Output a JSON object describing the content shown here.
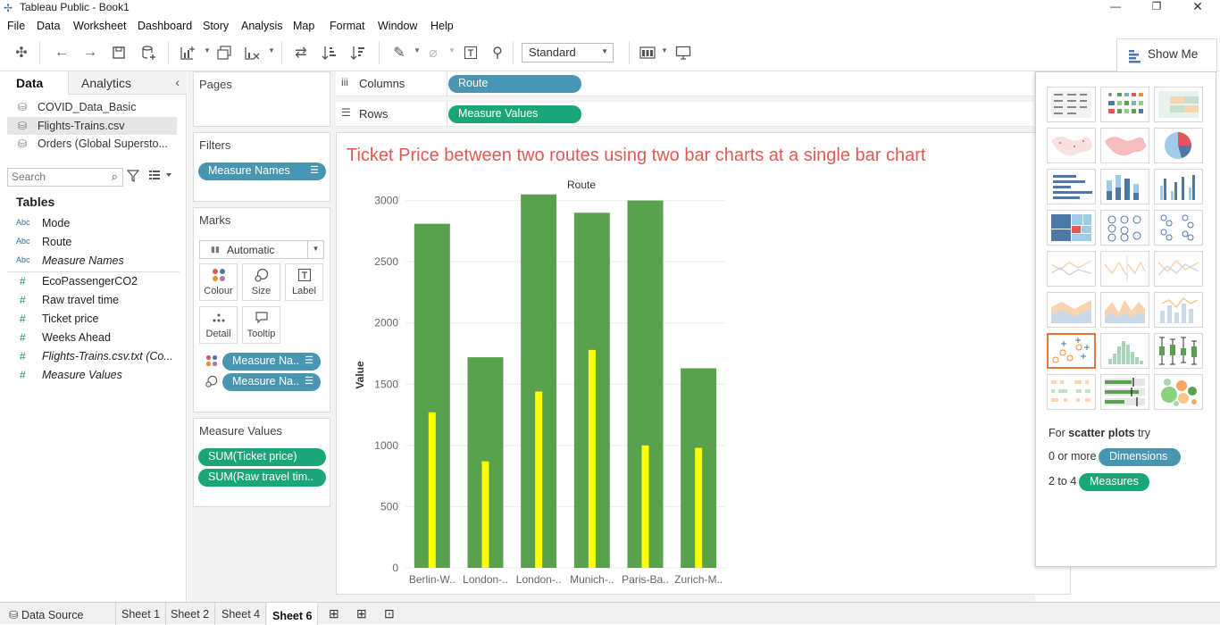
{
  "window": {
    "title": "Tableau Public - Book1"
  },
  "menu": [
    "File",
    "Data",
    "Worksheet",
    "Dashboard",
    "Story",
    "Analysis",
    "Map",
    "Format",
    "Window",
    "Help"
  ],
  "toolbar": {
    "fit_select": "Standard",
    "show_me_label": "Show Me"
  },
  "data_pane": {
    "tabs": {
      "data": "Data",
      "analytics": "Analytics"
    },
    "sources": [
      "COVID_Data_Basic",
      "Flights-Trains.csv",
      "Orders (Global Supersto..."
    ],
    "search_placeholder": "Search",
    "tables_heading": "Tables",
    "dimensions": [
      {
        "type": "Abc",
        "label": "Mode"
      },
      {
        "type": "Abc",
        "label": "Route"
      },
      {
        "type": "Abc",
        "label": "Measure Names"
      }
    ],
    "measures": [
      {
        "type": "#",
        "label": "EcoPassengerCO2"
      },
      {
        "type": "#",
        "label": "Raw travel time"
      },
      {
        "type": "#",
        "label": "Ticket price"
      },
      {
        "type": "#",
        "label": "Weeks Ahead"
      },
      {
        "type": "#",
        "label": "Flights-Trains.csv.txt (Co..."
      },
      {
        "type": "#",
        "label": "Measure Values"
      }
    ]
  },
  "cards": {
    "pages": "Pages",
    "filters": {
      "title": "Filters",
      "pill": "Measure Names"
    },
    "marks": {
      "title": "Marks",
      "type": "Automatic",
      "buttons": [
        "Colour",
        "Size",
        "Label",
        "Detail",
        "Tooltip"
      ],
      "pills": [
        "Measure Na..",
        "Measure Na.."
      ]
    },
    "measure_values": {
      "title": "Measure Values",
      "pills": [
        "SUM(Ticket price)",
        "SUM(Raw travel tim.."
      ]
    }
  },
  "shelves": {
    "columns": {
      "label": "Columns",
      "pill": "Route"
    },
    "rows": {
      "label": "Rows",
      "pill": "Measure Values"
    }
  },
  "chart_title": "Ticket Price between two routes using two bar charts at a single bar chart",
  "chart_data": {
    "type": "bar",
    "title": "Ticket Price between two routes using two bar charts at a single bar chart",
    "xlabel": "Route",
    "ylabel": "Value",
    "ylim": [
      0,
      3150
    ],
    "yticks": [
      0,
      500,
      1000,
      1500,
      2000,
      2500,
      3000
    ],
    "categories": [
      "Berlin-W..",
      "London-..",
      "London-..",
      "Munich-..",
      "Paris-Ba..",
      "Zurich-M.."
    ],
    "series": [
      {
        "values": [
          2810,
          1720,
          3050,
          2900,
          3000,
          1630
        ],
        "color": "#59a14f"
      },
      {
        "values": [
          1270,
          870,
          1440,
          1780,
          1000,
          980
        ],
        "color": "#ffff00"
      }
    ],
    "grid": true,
    "legend": "none"
  },
  "show_me": {
    "hint_prefix": "For",
    "hint_bold": "scatter plots",
    "hint_suffix": "try",
    "req1_prefix": "0 or more",
    "req1_pill": "Dimensions",
    "req2_prefix": "2 to 4",
    "req2_pill": "Measures"
  },
  "bottom_tabs": [
    "Data Source",
    "Sheet 1",
    "Sheet 2",
    "Sheet 4",
    "Sheet 6"
  ]
}
